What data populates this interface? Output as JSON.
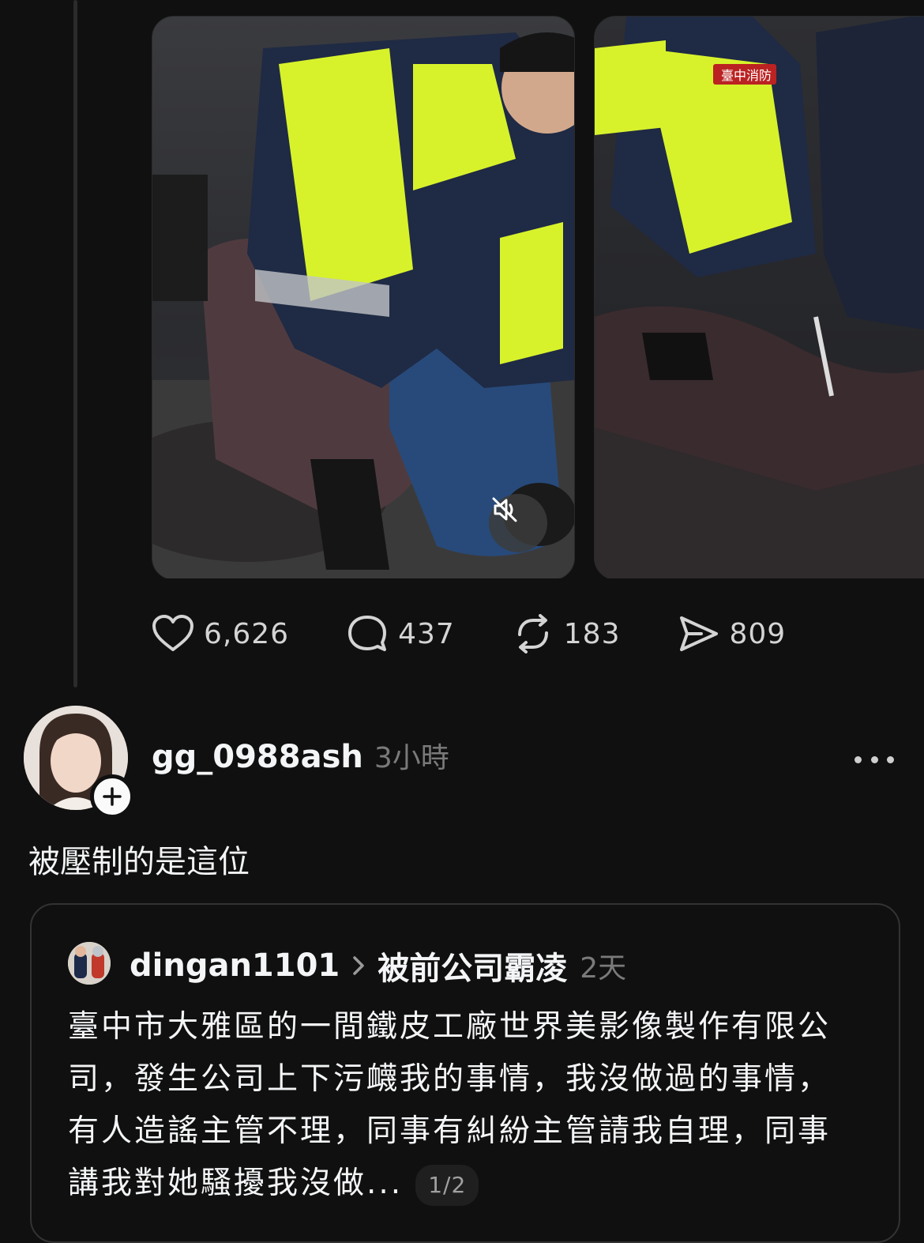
{
  "stats": {
    "likes": "6,626",
    "comments": "437",
    "reposts": "183",
    "shares": "809"
  },
  "reply": {
    "username": "gg_0988ash",
    "time": "3小時",
    "text": "被壓制的是這位"
  },
  "quote": {
    "username": "dingan1101",
    "topic": "被前公司霸凌",
    "time": "2天",
    "body": "臺中市大雅區的一間鐵皮工廠世界美影像製作有限公司，發生公司上下污衊我的事情，我沒做過的事情，有人造謠主管不理，同事有糾紛主管請我自理，同事講我對她騷擾我沒做...",
    "page_indicator": "1/2"
  },
  "media": {
    "vest_text": "臺中消防"
  },
  "icons": [
    "heart-icon",
    "comment-icon",
    "repost-icon",
    "share-icon",
    "mute-icon",
    "plus-icon",
    "more-icon",
    "chevron-right-icon"
  ],
  "colors": {
    "background": "#101010",
    "text_primary": "#f3f5f7",
    "text_secondary": "#7a7a7a",
    "vest_yellow": "#d7f22b"
  }
}
